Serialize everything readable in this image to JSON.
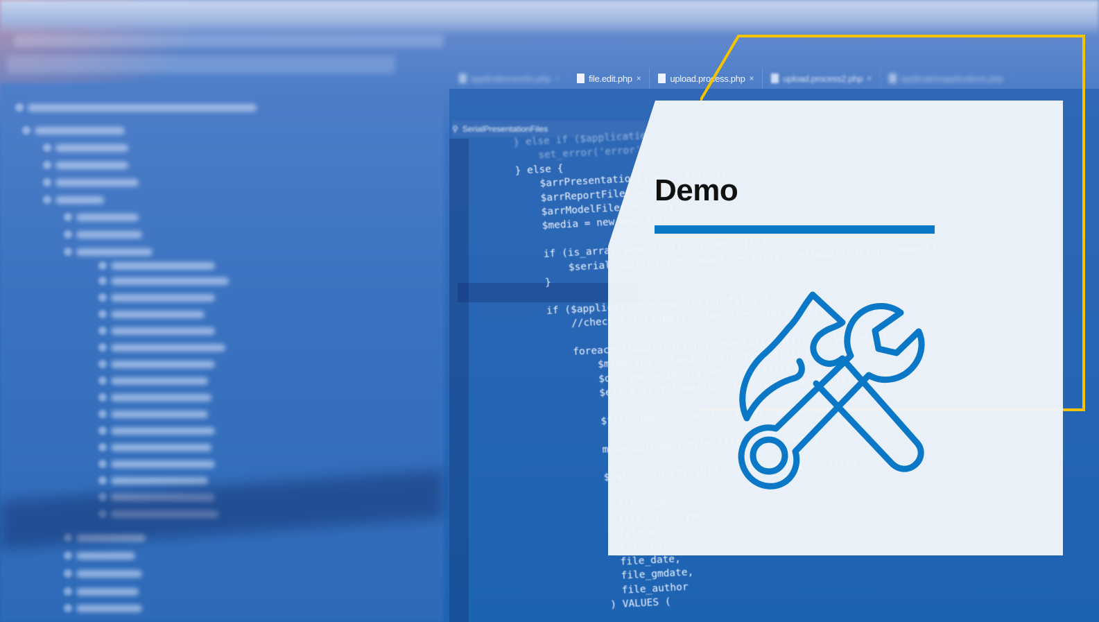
{
  "background": {
    "editor_tabs": [
      {
        "label": "applicationworks.php",
        "blur": "strong"
      },
      {
        "label": "file.edit.php",
        "blur": "none"
      },
      {
        "label": "upload.process.php",
        "blur": "none"
      },
      {
        "label": "upload.process2.php",
        "blur": "light"
      },
      {
        "label": "applicationapplications.php",
        "blur": "strong"
      }
    ],
    "search_filter_label": "SerialPresentationFiles",
    "code_lines": [
      "} else if ($application_presentation_file && (count($application_presentation",
      "    set_error('error', 'On el = ' json_encode($application_presentation_file));",
      "} else {",
      "    $arrPresentationFiles = array();",
      "    $arrReportFiles = array();",
      "    $arrModelFiles = array();",
      "    $media = new media();",
      "",
      "    if (is_array($application_numbers)) {",
      "        $serial_application_numbers = serialize($application_numbers);",
      "    }",
      "",
      "    if ($application_presentation_file) {",
      "        //check_file($application_presentation_file);",
      "",
      "        foreach ($application_presentation_file as $value) {",
      "            $mimetype = $media->mimetype($file);",
      "            $doctype = $media->doctype($file);",
      "            $ext = strtolower($media->extension($file));",
      "",
      "            $file_name = time() . $application_id;",
      "",
      "            move_uploaded_file($file['tmp_name'],",
      "",
      "            $sql = \"INSERT INTO \" . DB_PREFIX . \"files",
      "",
      "              file_name,",
      "              file_size_type,",
      "              file_mime,",
      "              file_path,",
      "              file_date,",
      "              file_gmdate,",
      "              file_author",
      "            ) VALUES ("
    ]
  },
  "card": {
    "title": "Demo",
    "icon": "wrench-and-screwdriver-icon"
  },
  "colors": {
    "accent_frame": "#F5C400",
    "title_rule": "#0A78C6",
    "icon_stroke": "#0A78C6",
    "card_bg": "#F0F5FA"
  }
}
